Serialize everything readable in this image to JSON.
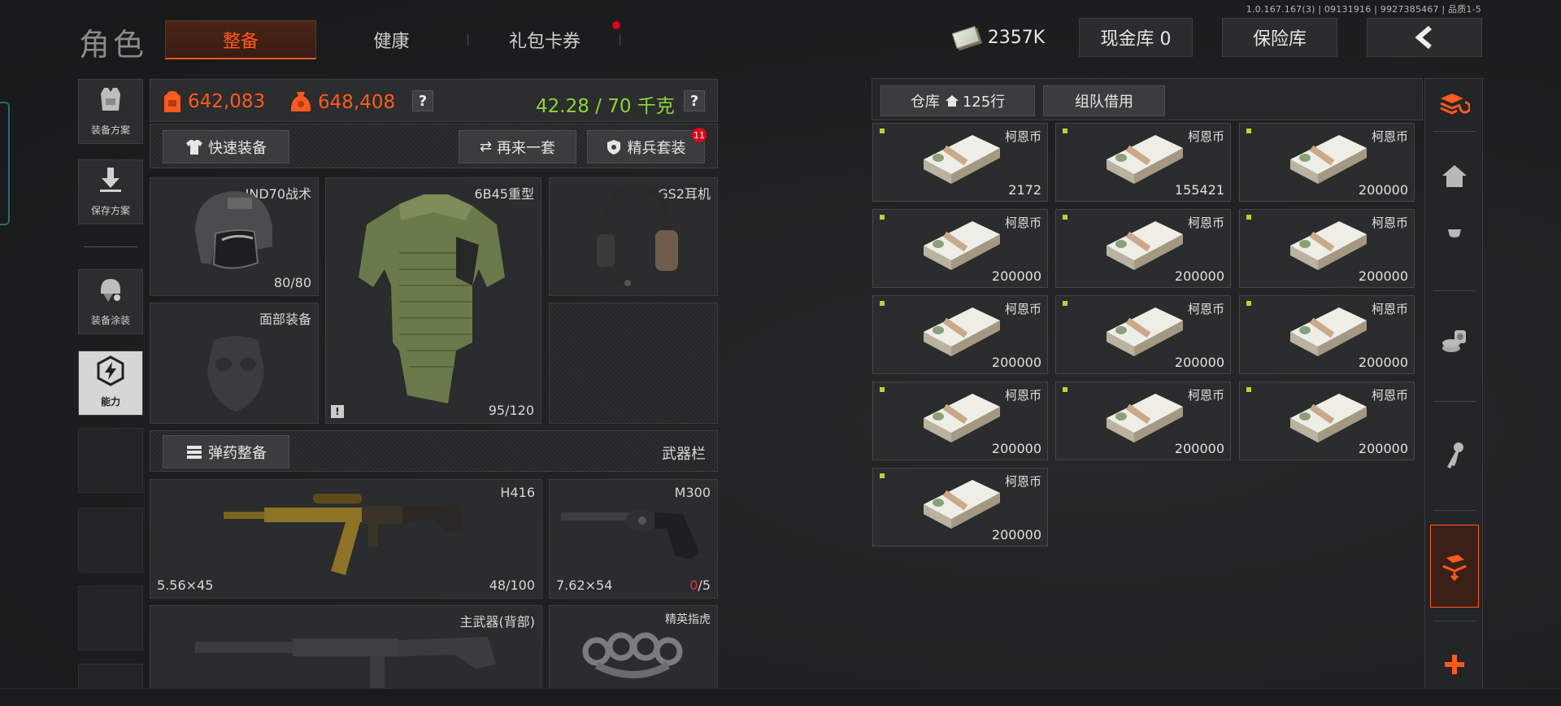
{
  "version": "1.0.167.167(3) | 09131916 | 9927385467 | 品质1-5",
  "page_title": "角色",
  "tabs": [
    {
      "label": "整备",
      "active": true
    },
    {
      "label": "健康",
      "active": false
    },
    {
      "label": "礼包卡券",
      "active": false
    }
  ],
  "currency": {
    "amount": "2357K"
  },
  "topbar": {
    "cash_vault": "现金库 0",
    "safe_vault": "保险库"
  },
  "left_rail": [
    {
      "label": "装备方案",
      "icon": "vest-icon"
    },
    {
      "label": "保存方案",
      "icon": "save-down-icon"
    },
    {
      "label": "装备涂装",
      "icon": "helmet-paint-icon"
    },
    {
      "label": "能力",
      "icon": "ability-icon"
    }
  ],
  "stats": {
    "carry_value": "642,083",
    "total_value": "648,408",
    "weight": "42.28 / 70 千克"
  },
  "buttons": {
    "quick_equip": "快速装备",
    "redo": "再来一套",
    "elite_set": "精兵套装",
    "elite_badge": "11",
    "ammo_equip": "弹药整备"
  },
  "slots": {
    "helmet": {
      "name": "IND70战术",
      "durability": "80/80"
    },
    "armor": {
      "name": "6B45重型",
      "durability": "95/120"
    },
    "headset": {
      "name": "GS2耳机"
    },
    "face": {
      "name": "面部装备"
    },
    "weapon_bar": "武器栏",
    "primary": {
      "name": "H416",
      "caliber": "5.56×45",
      "ammo": "48/100"
    },
    "pistol": {
      "name": "M300",
      "caliber": "7.62×54",
      "ammo_current": "0",
      "ammo_max": "/5"
    },
    "back_weapon": {
      "name": "主武器(背部)"
    },
    "melee": {
      "name": "精英指虎"
    }
  },
  "stash": {
    "tab_label": "仓库",
    "rows": "125行",
    "team_borrow": "组队借用",
    "items": [
      {
        "name": "柯恩币",
        "count": "2172"
      },
      {
        "name": "柯恩币",
        "count": "155421"
      },
      {
        "name": "柯恩币",
        "count": "200000"
      },
      {
        "name": "柯恩币",
        "count": "200000"
      },
      {
        "name": "柯恩币",
        "count": "200000"
      },
      {
        "name": "柯恩币",
        "count": "200000"
      },
      {
        "name": "柯恩币",
        "count": "200000"
      },
      {
        "name": "柯恩币",
        "count": "200000"
      },
      {
        "name": "柯恩币",
        "count": "200000"
      },
      {
        "name": "柯恩币",
        "count": "200000"
      },
      {
        "name": "柯恩币",
        "count": "200000"
      },
      {
        "name": "柯恩币",
        "count": "200000"
      },
      {
        "name": "柯恩币",
        "count": "200000"
      }
    ]
  },
  "colors": {
    "accent": "#ff5a1f",
    "weight_ok": "#8fd43a",
    "badge": "#e3001b"
  }
}
